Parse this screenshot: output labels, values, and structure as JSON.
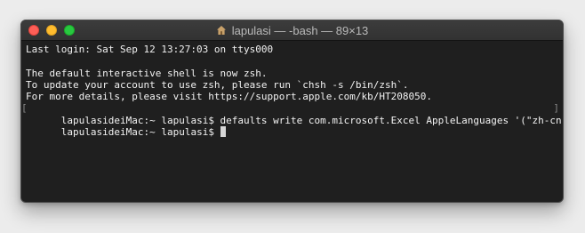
{
  "window": {
    "title": "lapulasi — -bash — 89×13",
    "title_icon": "home-folder-icon"
  },
  "colors": {
    "close": "#fe5f57",
    "minimize": "#febc2e",
    "zoom": "#28c840",
    "terminal_bg": "#1f1f1f",
    "terminal_text": "#f2f2f2"
  },
  "terminal": {
    "last_login": "Last login: Sat Sep 12 13:27:03 on ttys000",
    "blank": "",
    "shell_notice": "The default interactive shell is now zsh.",
    "update_notice": "To update your account to use zsh, please run `chsh -s /bin/zsh`.",
    "details_notice": "For more details, please visit https://support.apple.com/kb/HT208050.",
    "command_line": "lapulasideiMac:~ lapulasi$ defaults write com.microsoft.Excel AppleLanguages '(\"zh-cn\")'",
    "prompt": "lapulasideiMac:~ lapulasi$ "
  }
}
